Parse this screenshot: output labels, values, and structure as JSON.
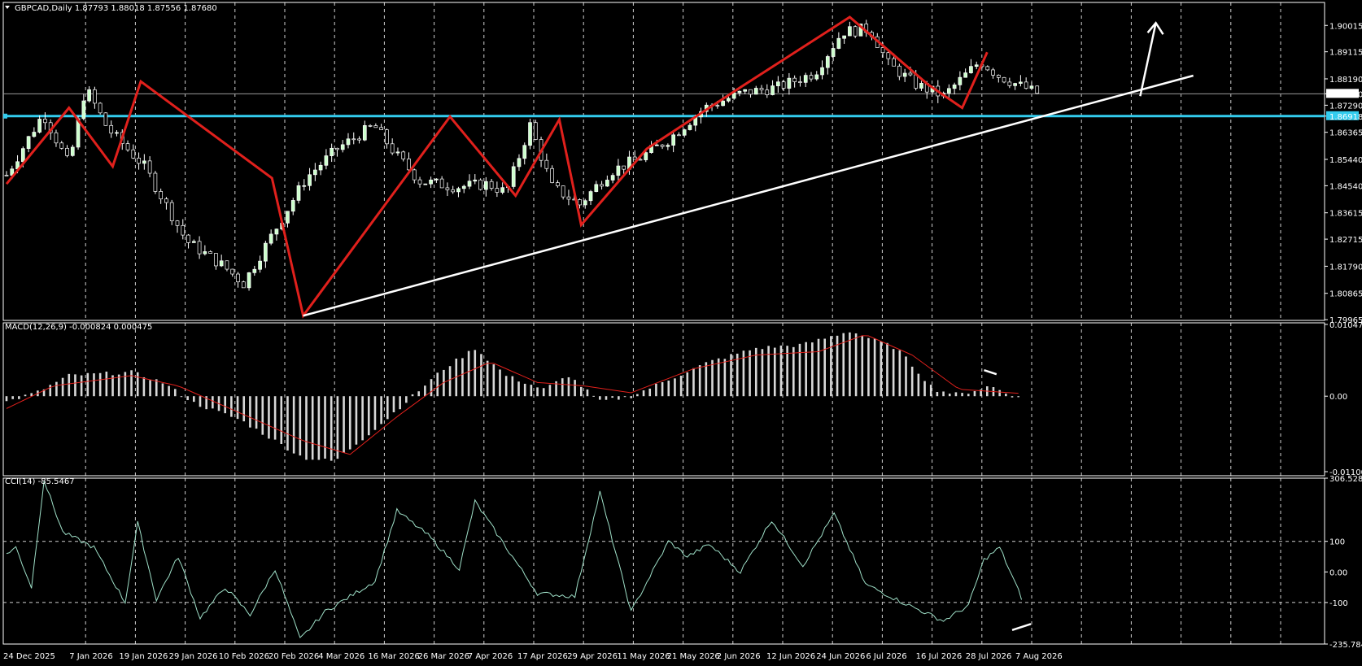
{
  "chart_data": {
    "type": "candlestick",
    "symbol_header": "GBPCAD,Daily  1.87793 1.88018 1.87556 1.87680",
    "date_ticks": [
      "24 Dec 2025",
      "7 Jan 2026",
      "19 Jan 2026",
      "29 Jan 2026",
      "10 Feb 2026",
      "20 Feb 2026",
      "4 Mar 2026",
      "16 Mar 2026",
      "26 Mar 2026",
      "7 Apr 2026",
      "17 Apr 2026",
      "29 Apr 2026",
      "11 May 2026",
      "21 May 2026",
      "2 Jun 2026",
      "12 Jun 2026",
      "24 Jun 2026",
      "6 Jul 2026",
      "16 Jul 2026",
      "28 Jul 2026",
      "7 Aug 2026"
    ],
    "price": {
      "ylim": [
        1.7994,
        1.908
      ],
      "ticks": [
        "1.90015",
        "1.89115",
        "1.88190",
        "1.87680",
        "1.87290",
        "1.86918",
        "1.86365",
        "1.85440",
        "1.84540",
        "1.83615",
        "1.82715",
        "1.81790",
        "1.80865",
        "1.79965"
      ],
      "current_price": 1.8768,
      "support_level": 1.86918,
      "support_color": "#33ccee",
      "anchors": [
        [
          0,
          1.849
        ],
        [
          20,
          1.87
        ],
        [
          34,
          1.8525
        ],
        [
          43,
          1.879
        ],
        [
          55,
          1.865
        ],
        [
          75,
          1.852
        ],
        [
          98,
          1.8265
        ],
        [
          118,
          1.818
        ],
        [
          129,
          1.812
        ],
        [
          144,
          1.828
        ],
        [
          163,
          1.848
        ],
        [
          180,
          1.858
        ],
        [
          200,
          1.866
        ],
        [
          212,
          1.856
        ],
        [
          225,
          1.847
        ],
        [
          245,
          1.845
        ],
        [
          262,
          1.846
        ],
        [
          272,
          1.843
        ],
        [
          285,
          1.866
        ],
        [
          297,
          1.845
        ],
        [
          312,
          1.839
        ],
        [
          328,
          1.85
        ],
        [
          345,
          1.855
        ],
        [
          360,
          1.861
        ],
        [
          380,
          1.872
        ],
        [
          400,
          1.877
        ],
        [
          420,
          1.879
        ],
        [
          440,
          1.884
        ],
        [
          455,
          1.898
        ],
        [
          470,
          1.899
        ],
        [
          480,
          1.887
        ],
        [
          495,
          1.88
        ],
        [
          510,
          1.876
        ],
        [
          520,
          1.882
        ],
        [
          530,
          1.888
        ],
        [
          540,
          1.883
        ],
        [
          550,
          1.88
        ],
        [
          561,
          1.877
        ]
      ],
      "zigzag": [
        [
          0,
          1.846
        ],
        [
          20,
          1.872
        ],
        [
          34,
          1.852
        ],
        [
          43,
          1.881
        ],
        [
          85,
          1.848
        ],
        [
          95,
          1.801
        ],
        [
          142,
          1.869
        ],
        [
          163,
          1.842
        ],
        [
          177,
          1.868
        ],
        [
          184,
          1.832
        ],
        [
          205,
          1.858
        ],
        [
          235,
          1.879
        ],
        [
          270,
          1.903
        ],
        [
          295,
          1.88
        ],
        [
          306,
          1.872
        ],
        [
          314,
          1.891
        ]
      ],
      "trendline": [
        [
          95,
          1.801
        ],
        [
          380,
          1.883
        ]
      ],
      "arrow": [
        [
          363,
          1.876
        ],
        [
          368,
          1.901
        ]
      ]
    },
    "macd": {
      "header": "MACD(12,26,9) -0.000824 0.000475",
      "ylim": [
        -0.0116,
        0.0107
      ],
      "ticks": [
        "0.010475",
        "0.00",
        "-0.011007"
      ],
      "anchors": [
        [
          0,
          -0.0008
        ],
        [
          10,
          0.0006
        ],
        [
          20,
          0.003
        ],
        [
          40,
          0.0035
        ],
        [
          50,
          0.002
        ],
        [
          60,
          -0.001
        ],
        [
          75,
          -0.0035
        ],
        [
          95,
          -0.009
        ],
        [
          105,
          -0.0095
        ],
        [
          120,
          -0.004
        ],
        [
          130,
          0.0
        ],
        [
          140,
          0.004
        ],
        [
          150,
          0.007
        ],
        [
          160,
          0.003
        ],
        [
          172,
          0.001
        ],
        [
          180,
          0.003
        ],
        [
          190,
          -0.0008
        ],
        [
          200,
          0.0
        ],
        [
          210,
          0.002
        ],
        [
          225,
          0.005
        ],
        [
          240,
          0.007
        ],
        [
          255,
          0.0075
        ],
        [
          270,
          0.0095
        ],
        [
          285,
          0.007
        ],
        [
          297,
          0.001
        ],
        [
          305,
          0.0002
        ],
        [
          315,
          0.0015
        ],
        [
          325,
          -0.0005
        ]
      ],
      "signal_anchors": [
        [
          0,
          -0.0018
        ],
        [
          15,
          0.0015
        ],
        [
          40,
          0.003
        ],
        [
          55,
          0.0015
        ],
        [
          70,
          -0.0015
        ],
        [
          95,
          -0.0065
        ],
        [
          110,
          -0.0085
        ],
        [
          125,
          -0.003
        ],
        [
          140,
          0.002
        ],
        [
          155,
          0.005
        ],
        [
          170,
          0.002
        ],
        [
          185,
          0.0015
        ],
        [
          200,
          0.0005
        ],
        [
          220,
          0.004
        ],
        [
          240,
          0.006
        ],
        [
          260,
          0.0065
        ],
        [
          275,
          0.009
        ],
        [
          290,
          0.006
        ],
        [
          305,
          0.001
        ],
        [
          325,
          0.0004
        ]
      ],
      "divergence_mark": [
        [
          313,
          0.0038
        ],
        [
          317,
          0.0032
        ]
      ]
    },
    "cci": {
      "header": "CCI(14) -85.5467",
      "ylim": [
        -235.7849,
        306.5288
      ],
      "ticks": [
        "306.5288",
        "100",
        "0.00",
        "-100",
        "-235.7849"
      ],
      "levels": [
        100,
        -100
      ],
      "anchors": [
        [
          0,
          60
        ],
        [
          3,
          80
        ],
        [
          8,
          -50
        ],
        [
          12,
          300
        ],
        [
          18,
          130
        ],
        [
          28,
          80
        ],
        [
          38,
          -100
        ],
        [
          42,
          160
        ],
        [
          48,
          -90
        ],
        [
          55,
          50
        ],
        [
          62,
          -150
        ],
        [
          70,
          -50
        ],
        [
          78,
          -140
        ],
        [
          86,
          10
        ],
        [
          94,
          -220
        ],
        [
          102,
          -130
        ],
        [
          110,
          -80
        ],
        [
          118,
          -30
        ],
        [
          125,
          200
        ],
        [
          135,
          120
        ],
        [
          145,
          10
        ],
        [
          150,
          230
        ],
        [
          158,
          110
        ],
        [
          170,
          -70
        ],
        [
          182,
          -80
        ],
        [
          190,
          260
        ],
        [
          200,
          -130
        ],
        [
          212,
          100
        ],
        [
          218,
          50
        ],
        [
          225,
          90
        ],
        [
          235,
          0
        ],
        [
          245,
          170
        ],
        [
          255,
          20
        ],
        [
          265,
          190
        ],
        [
          275,
          -40
        ],
        [
          287,
          -100
        ],
        [
          300,
          -160
        ],
        [
          308,
          -110
        ],
        [
          313,
          40
        ],
        [
          318,
          80
        ],
        [
          325,
          -85
        ]
      ],
      "divergence_mark": [
        [
          322,
          -190
        ],
        [
          328,
          -170
        ]
      ]
    }
  }
}
